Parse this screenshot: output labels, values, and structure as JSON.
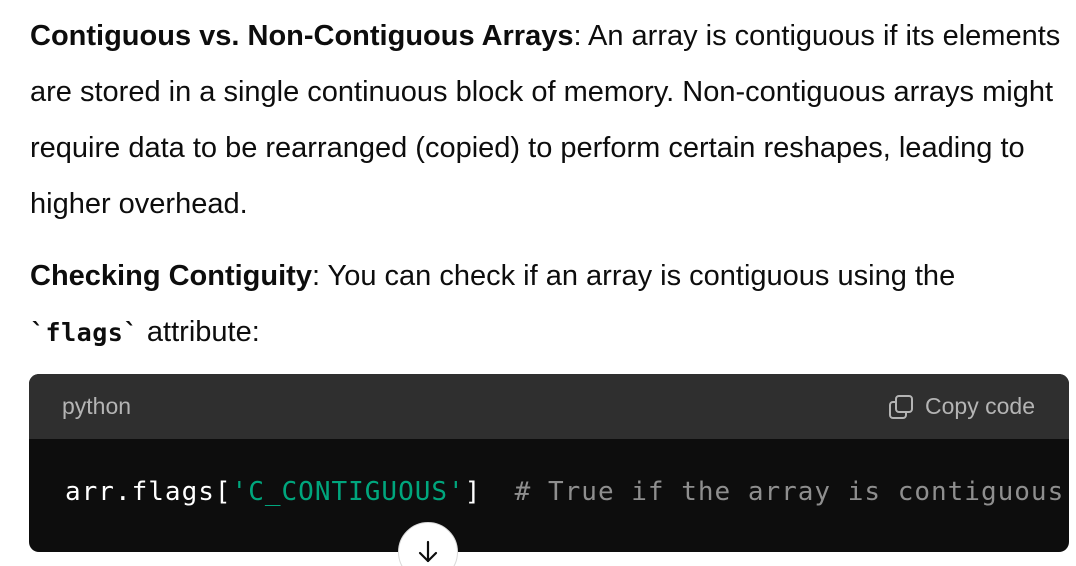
{
  "paragraphs": {
    "p1": {
      "bold": "Contiguous vs. Non-Contiguous Arrays",
      "text": ": An array is contiguous if its elements are stored in a single continuous block of memory. Non-contiguous arrays might require data to be rearranged (copied) to perform certain reshapes, leading to higher overhead."
    },
    "p2": {
      "bold": "Checking Contiguity",
      "text_before": ": You can check if an array is contiguous using the ",
      "code": "`flags`",
      "text_after": " attribute:"
    }
  },
  "code_block": {
    "language": "python",
    "copy_label": "Copy code",
    "code_prefix": "arr.flags[",
    "code_string": "'C_CONTIGUOUS'",
    "code_suffix": "]  ",
    "code_comment": "# True if the array is contiguous"
  },
  "icons": {
    "copy": "copy-icon",
    "scroll_down": "arrow-down-icon"
  },
  "colors": {
    "code_background": "#0d0d0d",
    "code_header_background": "#2f2f2f",
    "string_token": "#00a67d",
    "comment_token": "#8e8e8e"
  }
}
